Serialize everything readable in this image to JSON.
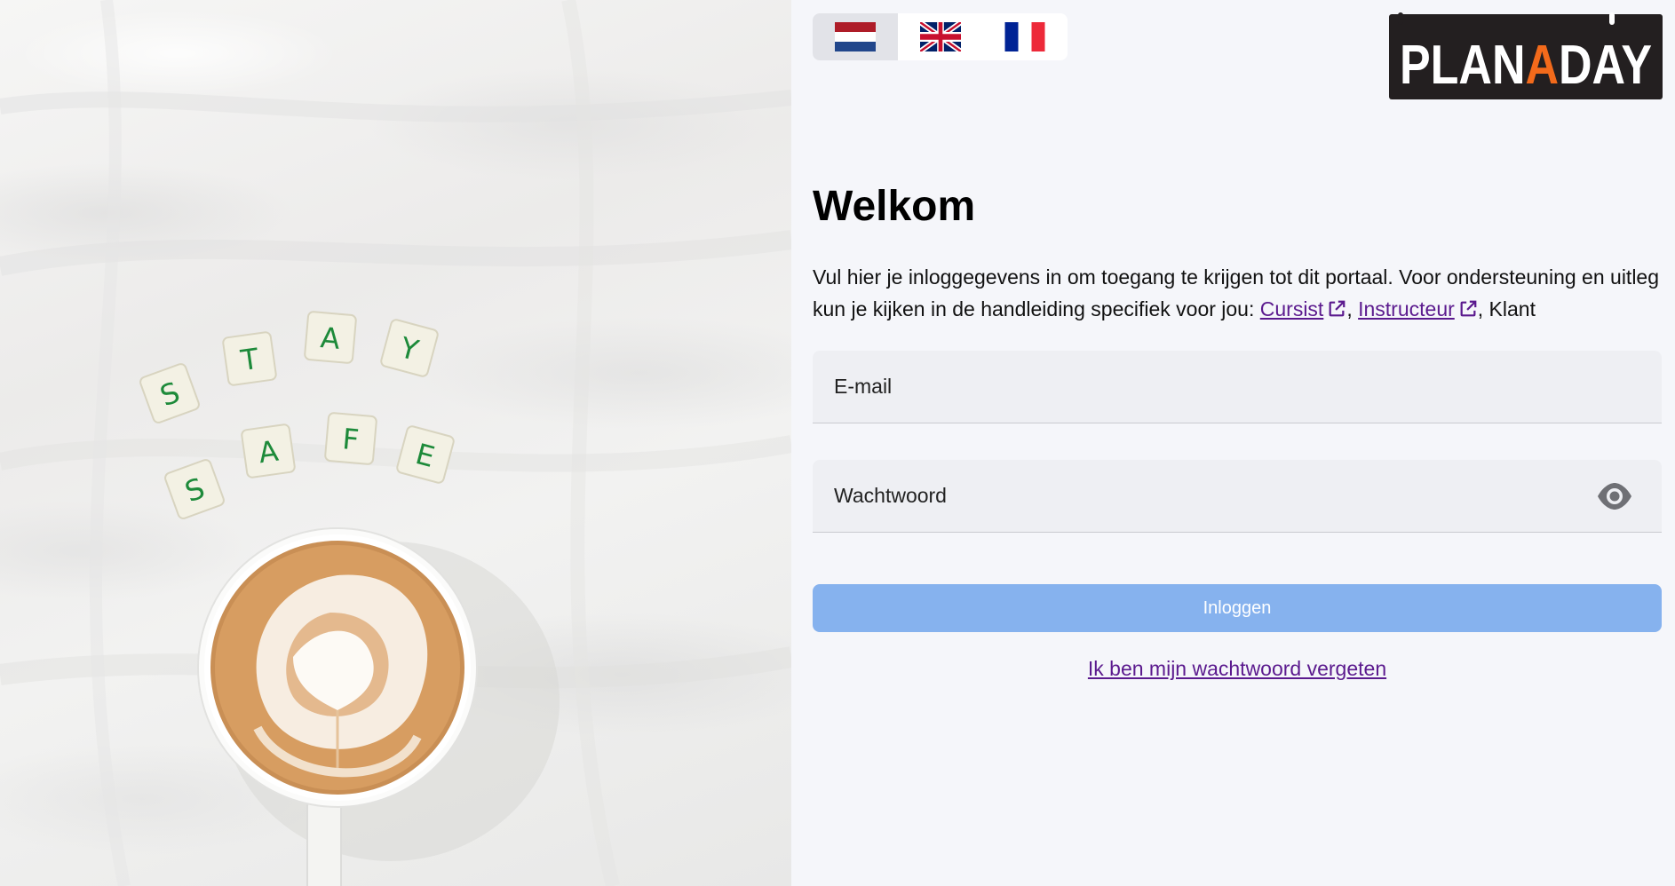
{
  "background_photo": {
    "tiles_row1": [
      "S",
      "T",
      "A",
      "Y"
    ],
    "tiles_row2": [
      "S",
      "A",
      "F",
      "E"
    ]
  },
  "languages": [
    {
      "code": "nl",
      "icon": "flag-netherlands-icon",
      "active": true
    },
    {
      "code": "en",
      "icon": "flag-united-kingdom-icon",
      "active": false
    },
    {
      "code": "fr",
      "icon": "flag-france-icon",
      "active": false
    }
  ],
  "logo": {
    "text_before": "PLAN",
    "text_accent": "A",
    "text_after": "DAY",
    "accent_color": "#f26a1b",
    "background_color": "#231f20"
  },
  "login": {
    "title": "Welkom",
    "intro_before": "Vul hier je inloggegevens in om toegang te krijgen tot dit portaal. Voor ondersteuning en uitleg kun je kijken in de handleiding specifiek voor jou: ",
    "link_cursist": "Cursist",
    "separator": ", ",
    "link_instructeur": "Instructeur",
    "intro_after": ", Klant",
    "email_placeholder": "E-mail",
    "password_placeholder": "Wachtwoord",
    "submit_label": "Inloggen",
    "forgot_label": "Ik ben mijn wachtwoord vergeten"
  },
  "colors": {
    "link": "#5b1a8e",
    "button": "#86b2ee",
    "tile_letter": "#1d8a3a"
  }
}
